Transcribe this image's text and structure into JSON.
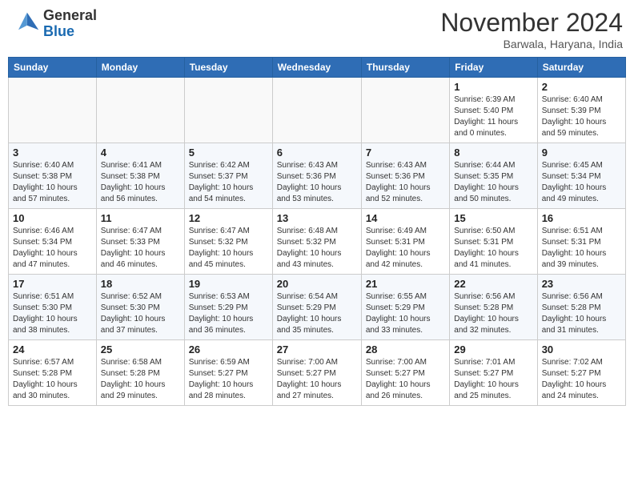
{
  "header": {
    "logo_line1": "General",
    "logo_line2": "Blue",
    "month": "November 2024",
    "location": "Barwala, Haryana, India"
  },
  "weekdays": [
    "Sunday",
    "Monday",
    "Tuesday",
    "Wednesday",
    "Thursday",
    "Friday",
    "Saturday"
  ],
  "weeks": [
    [
      {
        "day": "",
        "info": ""
      },
      {
        "day": "",
        "info": ""
      },
      {
        "day": "",
        "info": ""
      },
      {
        "day": "",
        "info": ""
      },
      {
        "day": "",
        "info": ""
      },
      {
        "day": "1",
        "info": "Sunrise: 6:39 AM\nSunset: 5:40 PM\nDaylight: 11 hours\nand 0 minutes."
      },
      {
        "day": "2",
        "info": "Sunrise: 6:40 AM\nSunset: 5:39 PM\nDaylight: 10 hours\nand 59 minutes."
      }
    ],
    [
      {
        "day": "3",
        "info": "Sunrise: 6:40 AM\nSunset: 5:38 PM\nDaylight: 10 hours\nand 57 minutes."
      },
      {
        "day": "4",
        "info": "Sunrise: 6:41 AM\nSunset: 5:38 PM\nDaylight: 10 hours\nand 56 minutes."
      },
      {
        "day": "5",
        "info": "Sunrise: 6:42 AM\nSunset: 5:37 PM\nDaylight: 10 hours\nand 54 minutes."
      },
      {
        "day": "6",
        "info": "Sunrise: 6:43 AM\nSunset: 5:36 PM\nDaylight: 10 hours\nand 53 minutes."
      },
      {
        "day": "7",
        "info": "Sunrise: 6:43 AM\nSunset: 5:36 PM\nDaylight: 10 hours\nand 52 minutes."
      },
      {
        "day": "8",
        "info": "Sunrise: 6:44 AM\nSunset: 5:35 PM\nDaylight: 10 hours\nand 50 minutes."
      },
      {
        "day": "9",
        "info": "Sunrise: 6:45 AM\nSunset: 5:34 PM\nDaylight: 10 hours\nand 49 minutes."
      }
    ],
    [
      {
        "day": "10",
        "info": "Sunrise: 6:46 AM\nSunset: 5:34 PM\nDaylight: 10 hours\nand 47 minutes."
      },
      {
        "day": "11",
        "info": "Sunrise: 6:47 AM\nSunset: 5:33 PM\nDaylight: 10 hours\nand 46 minutes."
      },
      {
        "day": "12",
        "info": "Sunrise: 6:47 AM\nSunset: 5:32 PM\nDaylight: 10 hours\nand 45 minutes."
      },
      {
        "day": "13",
        "info": "Sunrise: 6:48 AM\nSunset: 5:32 PM\nDaylight: 10 hours\nand 43 minutes."
      },
      {
        "day": "14",
        "info": "Sunrise: 6:49 AM\nSunset: 5:31 PM\nDaylight: 10 hours\nand 42 minutes."
      },
      {
        "day": "15",
        "info": "Sunrise: 6:50 AM\nSunset: 5:31 PM\nDaylight: 10 hours\nand 41 minutes."
      },
      {
        "day": "16",
        "info": "Sunrise: 6:51 AM\nSunset: 5:31 PM\nDaylight: 10 hours\nand 39 minutes."
      }
    ],
    [
      {
        "day": "17",
        "info": "Sunrise: 6:51 AM\nSunset: 5:30 PM\nDaylight: 10 hours\nand 38 minutes."
      },
      {
        "day": "18",
        "info": "Sunrise: 6:52 AM\nSunset: 5:30 PM\nDaylight: 10 hours\nand 37 minutes."
      },
      {
        "day": "19",
        "info": "Sunrise: 6:53 AM\nSunset: 5:29 PM\nDaylight: 10 hours\nand 36 minutes."
      },
      {
        "day": "20",
        "info": "Sunrise: 6:54 AM\nSunset: 5:29 PM\nDaylight: 10 hours\nand 35 minutes."
      },
      {
        "day": "21",
        "info": "Sunrise: 6:55 AM\nSunset: 5:29 PM\nDaylight: 10 hours\nand 33 minutes."
      },
      {
        "day": "22",
        "info": "Sunrise: 6:56 AM\nSunset: 5:28 PM\nDaylight: 10 hours\nand 32 minutes."
      },
      {
        "day": "23",
        "info": "Sunrise: 6:56 AM\nSunset: 5:28 PM\nDaylight: 10 hours\nand 31 minutes."
      }
    ],
    [
      {
        "day": "24",
        "info": "Sunrise: 6:57 AM\nSunset: 5:28 PM\nDaylight: 10 hours\nand 30 minutes."
      },
      {
        "day": "25",
        "info": "Sunrise: 6:58 AM\nSunset: 5:28 PM\nDaylight: 10 hours\nand 29 minutes."
      },
      {
        "day": "26",
        "info": "Sunrise: 6:59 AM\nSunset: 5:27 PM\nDaylight: 10 hours\nand 28 minutes."
      },
      {
        "day": "27",
        "info": "Sunrise: 7:00 AM\nSunset: 5:27 PM\nDaylight: 10 hours\nand 27 minutes."
      },
      {
        "day": "28",
        "info": "Sunrise: 7:00 AM\nSunset: 5:27 PM\nDaylight: 10 hours\nand 26 minutes."
      },
      {
        "day": "29",
        "info": "Sunrise: 7:01 AM\nSunset: 5:27 PM\nDaylight: 10 hours\nand 25 minutes."
      },
      {
        "day": "30",
        "info": "Sunrise: 7:02 AM\nSunset: 5:27 PM\nDaylight: 10 hours\nand 24 minutes."
      }
    ]
  ]
}
